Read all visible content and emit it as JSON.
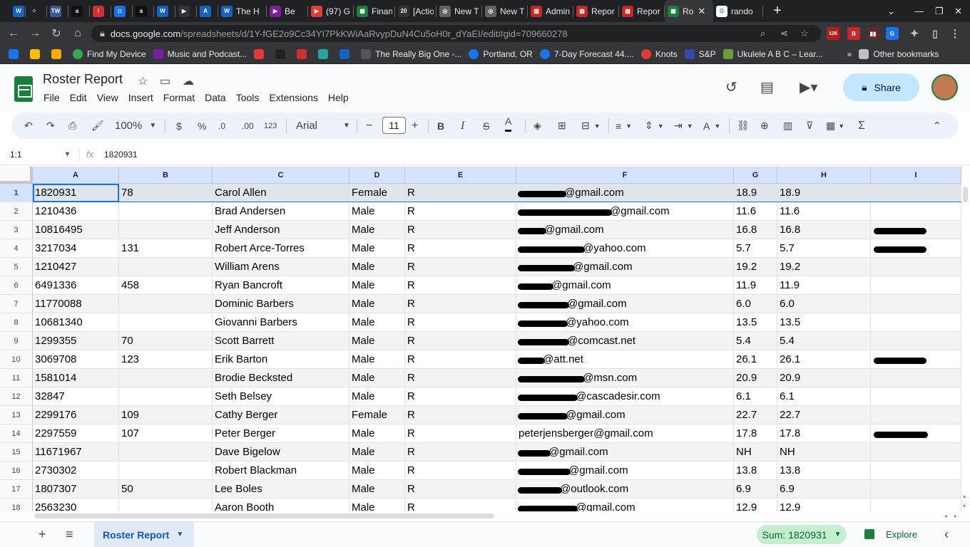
{
  "browser": {
    "tabs": [
      {
        "label": "",
        "fav": "W",
        "color": "#1565c0"
      },
      {
        "label": "",
        "fav": "⁘",
        "color": "#202124"
      },
      {
        "label": "",
        "fav": "TW",
        "color": "#3c5a99"
      },
      {
        "label": "",
        "fav": "a",
        "color": "#111"
      },
      {
        "label": "",
        "fav": "/",
        "color": "#d32f2f"
      },
      {
        "label": "",
        "fav": "◘",
        "color": "#1a73e8"
      },
      {
        "label": "",
        "fav": "a",
        "color": "#111"
      },
      {
        "label": "",
        "fav": "W",
        "color": "#1565c0"
      },
      {
        "label": "",
        "fav": "▶",
        "color": "#333"
      },
      {
        "label": "",
        "fav": "A",
        "color": "#1565c0"
      },
      {
        "label": "The H",
        "fav": "W",
        "color": "#1565c0"
      },
      {
        "label": "Be",
        "fav": "▶",
        "color": "#7b1fa2"
      },
      {
        "label": "(97) G",
        "fav": "▶",
        "color": "#e53935"
      },
      {
        "label": "Finan",
        "fav": "▦",
        "color": "#188038"
      },
      {
        "label": "[Action",
        "fav": "20",
        "color": "#333"
      },
      {
        "label": "New T",
        "fav": "◎",
        "color": "#5f6368"
      },
      {
        "label": "New T",
        "fav": "◎",
        "color": "#5f6368"
      },
      {
        "label": "Admin",
        "fav": "▨",
        "color": "#c62828"
      },
      {
        "label": "Repor",
        "fav": "▨",
        "color": "#c62828"
      },
      {
        "label": "Repor",
        "fav": "▨",
        "color": "#c62828"
      },
      {
        "label": "Ro",
        "fav": "▦",
        "color": "#188038",
        "active": true
      },
      {
        "label": "rando",
        "fav": "G",
        "color": "#fff"
      }
    ],
    "url_host": "docs.google.com",
    "url_path": "/spreadsheets/d/1Y-fGE2o9Cc34YI7PkKWiAaRvypDuN4Cu5oH0r_dYaEI/edit#gid=709660278",
    "bookmarks": [
      "Find My Device",
      "Music and Podcast...",
      "The Really Big One -...",
      "Portland, OR",
      "7-Day Forecast 44....",
      "Knots",
      "S&P",
      "Ukulele A B C – Lear..."
    ],
    "other_bookmarks": "Other bookmarks",
    "ext_badge": "126"
  },
  "doc": {
    "title": "Roster Report",
    "menu": [
      "File",
      "Edit",
      "View",
      "Insert",
      "Format",
      "Data",
      "Tools",
      "Extensions",
      "Help"
    ],
    "share_label": "Share"
  },
  "toolbar": {
    "zoom": "100%",
    "currency": "$",
    "percent": "%",
    "dec_minus": ".0",
    "dec_plus": ".00",
    "number_format": "123",
    "font": "Arial",
    "font_size": "11"
  },
  "formula": {
    "name_box": "1:1",
    "value": "1820931"
  },
  "grid": {
    "columns": [
      "A",
      "B",
      "C",
      "D",
      "E",
      "F",
      "G",
      "H",
      "I"
    ],
    "rows": [
      {
        "n": "1",
        "a": "1820931",
        "b": "78",
        "c": "Carol Allen",
        "d": "Female",
        "e": "R",
        "f": "@gmail.com",
        "g": "18.9",
        "h": "18.9",
        "i": ""
      },
      {
        "n": "2",
        "a": "1210436",
        "b": "",
        "c": "Brad Andersen",
        "d": "Male",
        "e": "R",
        "f": "@gmail.com",
        "g": "11.6",
        "h": "11.6",
        "i": ""
      },
      {
        "n": "3",
        "a": "10816495",
        "b": "",
        "c": "Jeff Anderson",
        "d": "Male",
        "e": "R",
        "f": "@gmail.com",
        "g": "16.8",
        "h": "16.8",
        "i": ""
      },
      {
        "n": "4",
        "a": "3217034",
        "b": "131",
        "c": "Robert Arce-Torres",
        "d": "Male",
        "e": "R",
        "f": "@yahoo.com",
        "g": "5.7",
        "h": "5.7",
        "i": ""
      },
      {
        "n": "5",
        "a": "1210427",
        "b": "",
        "c": "William Arens",
        "d": "Male",
        "e": "R",
        "f": "@gmail.com",
        "g": "19.2",
        "h": "19.2",
        "i": ""
      },
      {
        "n": "6",
        "a": "6491336",
        "b": "458",
        "c": "Ryan Bancroft",
        "d": "Male",
        "e": "R",
        "f": "@gmail.com",
        "g": "11.9",
        "h": "11.9",
        "i": ""
      },
      {
        "n": "7",
        "a": "11770088",
        "b": "",
        "c": "Dominic Barbers",
        "d": "Male",
        "e": "R",
        "f": "@gmail.com",
        "g": "6.0",
        "h": "6.0",
        "i": ""
      },
      {
        "n": "8",
        "a": "10681340",
        "b": "",
        "c": "Giovanni Barbers",
        "d": "Male",
        "e": "R",
        "f": "@yahoo.com",
        "g": "13.5",
        "h": "13.5",
        "i": ""
      },
      {
        "n": "9",
        "a": "1299355",
        "b": "70",
        "c": "Scott Barrett",
        "d": "Male",
        "e": "R",
        "f": "@comcast.net",
        "g": "5.4",
        "h": "5.4",
        "i": ""
      },
      {
        "n": "10",
        "a": "3069708",
        "b": "123",
        "c": "Erik Barton",
        "d": "Male",
        "e": "R",
        "f": "@att.net",
        "g": "26.1",
        "h": "26.1",
        "i": ""
      },
      {
        "n": "11",
        "a": "1581014",
        "b": "",
        "c": "Brodie Becksted",
        "d": "Male",
        "e": "R",
        "f": "@msn.com",
        "g": "20.9",
        "h": "20.9",
        "i": ""
      },
      {
        "n": "12",
        "a": "32847",
        "b": "",
        "c": "Seth Belsey",
        "d": "Male",
        "e": "R",
        "f": "@cascadesir.com",
        "g": "6.1",
        "h": "6.1",
        "i": ""
      },
      {
        "n": "13",
        "a": "2299176",
        "b": "109",
        "c": "Cathy Berger",
        "d": "Female",
        "e": "R",
        "f": "@gmail.com",
        "g": "22.7",
        "h": "22.7",
        "i": ""
      },
      {
        "n": "14",
        "a": "2297559",
        "b": "107",
        "c": "Peter Berger",
        "d": "Male",
        "e": "R",
        "f": "peterjensberger@gmail.com",
        "g": "17.8",
        "h": "17.8",
        "i": ""
      },
      {
        "n": "15",
        "a": "11671967",
        "b": "",
        "c": "Dave Bigelow",
        "d": "Male",
        "e": "R",
        "f": "@gmail.com",
        "g": "NH",
        "h": "NH",
        "i": ""
      },
      {
        "n": "16",
        "a": "2730302",
        "b": "",
        "c": "Robert Blackman",
        "d": "Male",
        "e": "R",
        "f": "@gmail.com",
        "g": "13.8",
        "h": "13.8",
        "i": ""
      },
      {
        "n": "17",
        "a": "1807307",
        "b": "50",
        "c": "Lee Boles",
        "d": "Male",
        "e": "R",
        "f": "@outlook.com",
        "g": "6.9",
        "h": "6.9",
        "i": ""
      },
      {
        "n": "18",
        "a": "2563230",
        "b": "",
        "c": "Aaron Booth",
        "d": "Male",
        "e": "R",
        "f": "@gmail.com",
        "g": "12.9",
        "h": "12.9",
        "i": ""
      }
    ]
  },
  "footer": {
    "sheet_name": "Roster Report",
    "sum": "Sum: 1820931",
    "explore": "Explore"
  }
}
